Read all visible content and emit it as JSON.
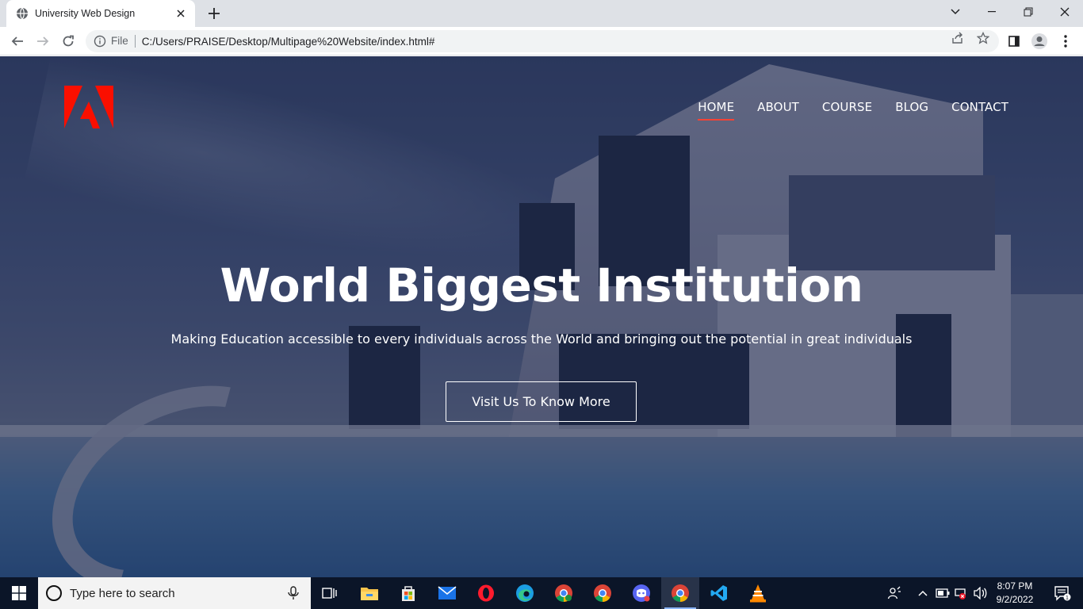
{
  "browser": {
    "tab_title": "University Web Design",
    "file_label": "File",
    "url": "C:/Users/PRAISE/Desktop/Multipage%20Website/index.html#"
  },
  "page": {
    "nav": [
      {
        "label": "HOME",
        "active": true
      },
      {
        "label": "ABOUT",
        "active": false
      },
      {
        "label": "COURSE",
        "active": false
      },
      {
        "label": "BLOG",
        "active": false
      },
      {
        "label": "CONTACT",
        "active": false
      }
    ],
    "headline": "World Biggest Institution",
    "tagline": "Making Education accessible to every individuals across the World and bringing out the potential in great individuals",
    "cta_label": "Visit Us To Know More",
    "accent_color": "#f44336",
    "logo_color": "#fa0f00"
  },
  "taskbar": {
    "search_placeholder": "Type here to search",
    "time": "8:07 PM",
    "date": "9/2/2022",
    "notification_count": "1",
    "apps": [
      "task-view",
      "file-explorer",
      "microsoft-store",
      "mail",
      "opera",
      "edge",
      "chrome-profile",
      "chrome",
      "discord-like",
      "chrome-active",
      "vs-code",
      "vlc"
    ]
  }
}
